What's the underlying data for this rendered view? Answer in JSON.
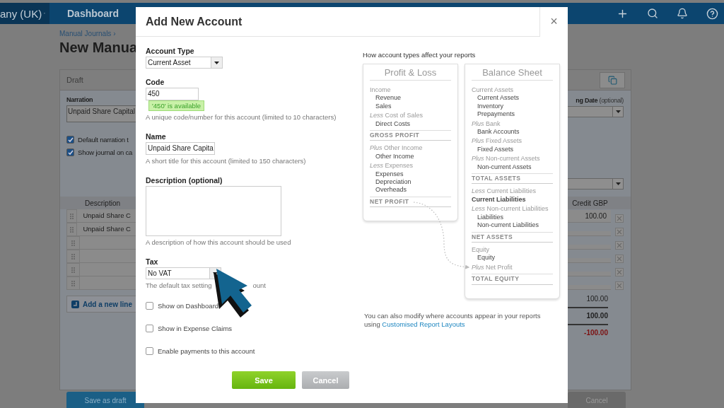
{
  "navbar": {
    "org_menu": "any (UK)",
    "links": [
      "Dashboard"
    ]
  },
  "page": {
    "breadcrumb": "Manual Journals ›",
    "title": "New Manua"
  },
  "journal": {
    "status": "Draft",
    "narration_label": "Narration",
    "narration_value": "Unpaid Share Capital",
    "options": [
      {
        "label": "Default narration t",
        "checked": true
      },
      {
        "label": "Show journal on ca",
        "checked": true
      }
    ],
    "date_label": "ng Date",
    "date_hint": "(optional)",
    "columns": [
      "Description",
      "Credit GBP"
    ],
    "rows": [
      {
        "kind": "filled",
        "description": "Unpaid Share C",
        "credit": "100.00"
      },
      {
        "kind": "filled",
        "description": "Unpaid Share C"
      },
      {
        "kind": "blank"
      },
      {
        "kind": "blank"
      },
      {
        "kind": "blank"
      },
      {
        "kind": "blank"
      }
    ],
    "add_line": "Add a new line",
    "totals": [
      {
        "kind": "subtotal",
        "value": "100.00"
      },
      {
        "kind": "total",
        "value": "100.00"
      },
      {
        "kind": "difference",
        "value": "-100.00"
      }
    ],
    "actions": [
      {
        "kind": "left",
        "label": "Save as draft"
      },
      {
        "kind": "right",
        "label": "Cancel"
      }
    ]
  },
  "modal": {
    "title": "Add New Account",
    "close": "×",
    "account_type": {
      "label": "Account Type",
      "value": "Current Asset"
    },
    "code": {
      "label": "Code",
      "value": "450",
      "status": "'450' is available",
      "hint": "A unique code/number for this account (limited to 10 characters)"
    },
    "name": {
      "label": "Name",
      "value": "Unpaid Share Capita",
      "hint": "A short title for this account (limited to 150 characters)"
    },
    "description": {
      "label": "Description (optional)",
      "hint": "A description of how this account should be used"
    },
    "tax": {
      "label": "Tax",
      "value": "No VAT",
      "hint": [
        "The default tax setting",
        "ount"
      ]
    },
    "options": [
      {
        "label": "Show on Dashboard",
        "checked": false
      },
      {
        "label": "Show in Expense Claims",
        "checked": false
      },
      {
        "label": "Enable payments to this account",
        "checked": false
      }
    ],
    "buttons": [
      {
        "kind": "primary",
        "label": "Save"
      },
      {
        "kind": "secondary",
        "label": "Cancel"
      }
    ],
    "help": {
      "heading": "How account types affect your reports",
      "reports": [
        {
          "title": "Profit & Loss",
          "lines": [
            {
              "kind": "group",
              "text": "Income"
            },
            {
              "kind": "item",
              "text": "Revenue"
            },
            {
              "kind": "item",
              "text": "Sales"
            },
            {
              "kind": "group",
              "text": "*Less* Cost of Sales"
            },
            {
              "kind": "item",
              "text": "Direct Costs"
            },
            {
              "kind": "total",
              "text": "GROSS PROFIT"
            },
            {
              "kind": "group",
              "text": "*Plus* Other Income"
            },
            {
              "kind": "item",
              "text": "Other Income"
            },
            {
              "kind": "group",
              "text": "*Less* Expenses"
            },
            {
              "kind": "item",
              "text": "Expenses"
            },
            {
              "kind": "item",
              "text": "Depreciation"
            },
            {
              "kind": "item",
              "text": "Overheads"
            },
            {
              "kind": "total",
              "text": "NET PROFIT"
            }
          ]
        },
        {
          "title": "Balance Sheet",
          "lines": [
            {
              "kind": "group",
              "text": "Current Assets"
            },
            {
              "kind": "item",
              "text": "Current Assets"
            },
            {
              "kind": "item",
              "text": "Inventory"
            },
            {
              "kind": "item",
              "text": "Prepayments"
            },
            {
              "kind": "group",
              "text": "*Plus* Bank"
            },
            {
              "kind": "item",
              "text": "Bank Accounts"
            },
            {
              "kind": "group",
              "text": "*Plus* Fixed Assets"
            },
            {
              "kind": "item",
              "text": "Fixed Assets"
            },
            {
              "kind": "group",
              "text": "*Plus* Non-current Assets"
            },
            {
              "kind": "item",
              "text": "Non-current Assets"
            },
            {
              "kind": "total",
              "text": "TOTAL ASSETS"
            },
            {
              "kind": "group",
              "text": "*Less* Current Liabilities"
            },
            {
              "kind": "flat",
              "text": "Current Liabilities"
            },
            {
              "kind": "group",
              "text": "*Less* Non-current Liabilities"
            },
            {
              "kind": "item",
              "text": "Liabilities"
            },
            {
              "kind": "item",
              "text": "Non-current Liabilities"
            },
            {
              "kind": "total",
              "text": "NET ASSETS"
            },
            {
              "kind": "group",
              "text": "Equity"
            },
            {
              "kind": "item",
              "text": "Equity"
            },
            {
              "kind": "group",
              "text": "*Plus* Net Profit"
            },
            {
              "kind": "total",
              "text": "TOTAL EQUITY"
            }
          ]
        }
      ],
      "note": "You can also modify where accounts appear in your reports using",
      "link": "Customised Report Layouts"
    }
  }
}
